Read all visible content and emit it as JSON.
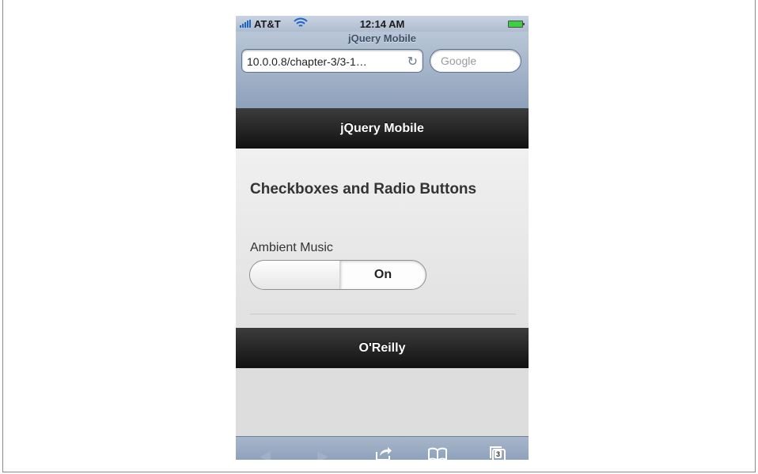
{
  "status_bar": {
    "carrier": "AT&T",
    "time": "12:14 AM"
  },
  "browser": {
    "page_title": "jQuery Mobile",
    "url": "10.0.0.8/chapter-3/3-1…",
    "search_placeholder": "Google",
    "tab_count": "3"
  },
  "header": {
    "title": "jQuery Mobile"
  },
  "content": {
    "heading": "Checkboxes and Radio Buttons",
    "field_label": "Ambient Music",
    "flip_switch_value": "On"
  },
  "footer": {
    "title": "O'Reilly"
  },
  "toolbar": {
    "icons": [
      "back-icon",
      "forward-icon",
      "share-icon",
      "bookmarks-icon",
      "tabs-icon"
    ]
  },
  "colors": {
    "bar_dark": "#1a1a1a",
    "content_bg": "#e8e8e8",
    "chrome_blue": "#8ea1bb",
    "battery_green": "#3bd141"
  }
}
